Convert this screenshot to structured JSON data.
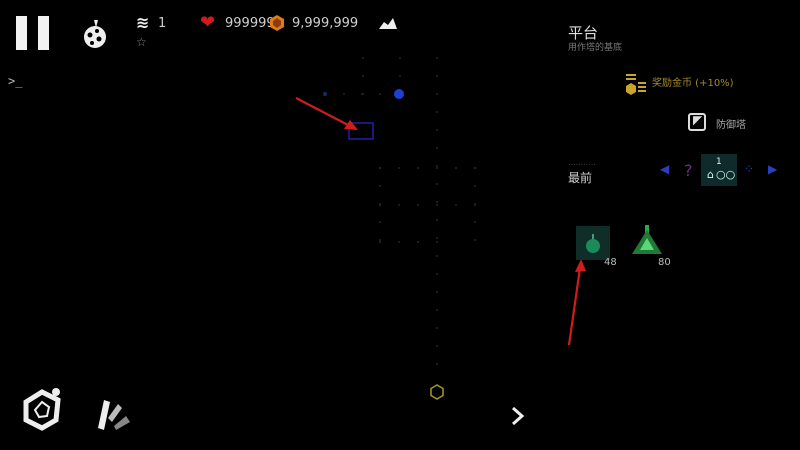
{
  "hud": {
    "waves": "1",
    "lives": "999999",
    "coins": "9,999,999"
  },
  "console": {
    "prompt": ">_"
  },
  "panel": {
    "title": "平台",
    "subtitle": "用作塔的基底",
    "reward": "奖励金币 (+10%)",
    "mode_label": "防御塔",
    "priority_hint": "...........",
    "priority_label": "最前",
    "question_mark": "?",
    "priority_level": "1",
    "towers": [
      {
        "name": "basic-tower",
        "cost": "48"
      },
      {
        "name": "green-tower",
        "cost": "80"
      }
    ]
  },
  "icons": {
    "pause": "pause-icon",
    "research": "research-icon",
    "wave": "wave-icon",
    "heart": "heart-icon",
    "coin": "coin-icon",
    "chart": "chart-icon",
    "console": "console-icon",
    "core": "core-icon",
    "speed": "speed-icon",
    "next": "next-icon"
  },
  "colors": {
    "heart": "#d11a1a",
    "coin": "#e07a1b",
    "reward": "#c9a52a",
    "annotation": "#d01c1c",
    "spawn": "#1e3fd6"
  }
}
